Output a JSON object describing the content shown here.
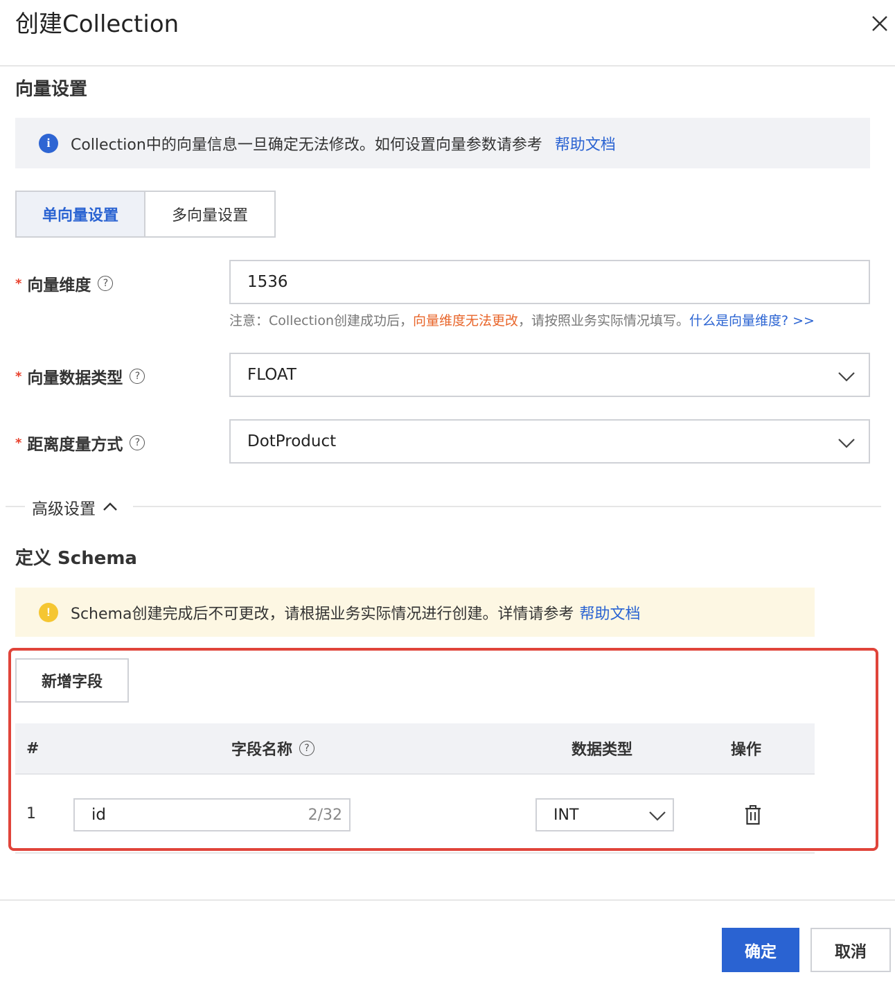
{
  "dialog": {
    "title": "创建Collection",
    "close_icon": "close-icon"
  },
  "vector_settings": {
    "section_title": "向量设置",
    "info_banner": {
      "icon": "info-icon",
      "text": "Collection中的向量信息一旦确定无法修改。如何设置向量参数请参考",
      "link": "帮助文档"
    },
    "tabs": [
      {
        "label": "单向量设置",
        "active": true
      },
      {
        "label": "多向量设置",
        "active": false
      }
    ],
    "dimension": {
      "label": "向量维度",
      "value": "1536",
      "note_prefix": "注意：Collection创建成功后，",
      "note_warn": "向量维度无法更改",
      "note_middle": "，请按照业务实际情况填写。",
      "note_link": "什么是向量维度? >>"
    },
    "data_type": {
      "label": "向量数据类型",
      "value": "FLOAT"
    },
    "distance_metric": {
      "label": "距离度量方式",
      "value": "DotProduct"
    },
    "required_mark": "*",
    "help_mark": "?",
    "advanced": {
      "label": "高级设置",
      "icon": "chevron-up-icon"
    }
  },
  "schema": {
    "section_title": "定义 Schema",
    "warn_banner": {
      "icon": "warning-icon",
      "mark": "!",
      "text": "Schema创建完成后不可更改，请根据业务实际情况进行创建。详情请参考",
      "link": "帮助文档"
    },
    "add_field_button": "新增字段",
    "table": {
      "headers": {
        "index": "#",
        "field_name": "字段名称",
        "data_type": "数据类型",
        "actions": "操作"
      },
      "rows": [
        {
          "index": "1",
          "field_name": "id",
          "char_count": "2/32",
          "data_type": "INT",
          "action_icon": "trash-icon"
        }
      ]
    }
  },
  "footer": {
    "confirm": "确定",
    "cancel": "取消"
  },
  "colors": {
    "primary": "#2a63d2",
    "required": "#e8402c",
    "warning_text": "#e8652a",
    "highlight_box": "#e0443a"
  }
}
